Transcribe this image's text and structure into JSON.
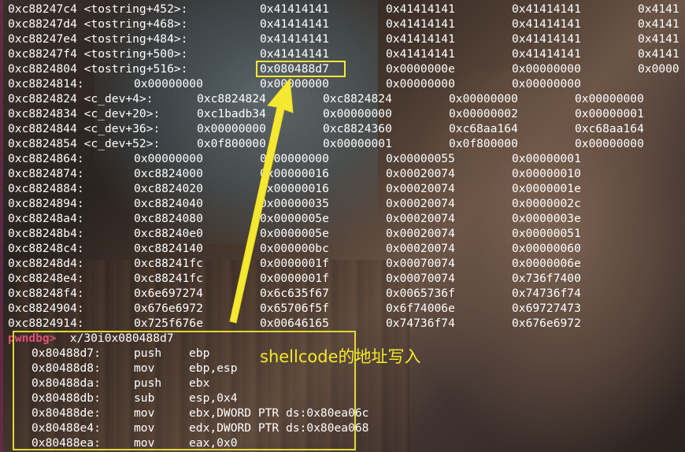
{
  "memory_rows": [
    [
      "0xc88247c4 <tostring+452>:",
      "0x41414141",
      "0x41414141",
      "0x41414141",
      "0x4141"
    ],
    [
      "0xc88247d4 <tostring+468>:",
      "0x41414141",
      "0x41414141",
      "0x41414141",
      "0x4141"
    ],
    [
      "0xc88247e4 <tostring+484>:",
      "0x41414141",
      "0x41414141",
      "0x41414141",
      "0x4141"
    ],
    [
      "0xc88247f4 <tostring+500>:",
      "0x41414141",
      "0x41414141",
      "0x41414141",
      "0x4141"
    ],
    [
      "0xc8824804 <tostring+516>:",
      "0x080488d7",
      "0x0000000e",
      "0x00000000",
      "0x0000"
    ]
  ],
  "row_short": [
    "0xc8824814:",
    "0x00000000",
    "0x00000000",
    "0x00000000",
    "0x00000000"
  ],
  "cdev_rows": [
    [
      "0xc8824824 <c_dev+4>:",
      "0xc8824824",
      "0xc8824824",
      "0x00000000",
      "0x00000000"
    ],
    [
      "0xc8824834 <c_dev+20>:",
      "0xc1badb34",
      "0x00000000",
      "0x00000002",
      "0x00000001"
    ],
    [
      "0xc8824844 <c_dev+36>:",
      "0x00000000",
      "0xc8824360",
      "0xc68aa164",
      "0xc68aa164"
    ],
    [
      "0xc8824854 <c_dev+52>:",
      "0x0f800000",
      "0x00000001",
      "0x0f800000",
      "0x00000000"
    ]
  ],
  "plain_rows": [
    [
      "0xc8824864:",
      "0x00000000",
      "0x00000000",
      "0x00000055",
      "0x00000001"
    ],
    [
      "0xc8824874:",
      "0xc8824000",
      "0x00000016",
      "0x00020074",
      "0x00000010"
    ],
    [
      "0xc8824884:",
      "0xc8824020",
      "0x00000016",
      "0x00020074",
      "0x0000001e"
    ],
    [
      "0xc8824894:",
      "0xc8824040",
      "0x00000035",
      "0x00020074",
      "0x0000002c"
    ],
    [
      "0xc88248a4:",
      "0xc8824080",
      "0x0000005e",
      "0x00020074",
      "0x0000003e"
    ],
    [
      "0xc88248b4:",
      "0xc88240e0",
      "0x0000005e",
      "0x00020074",
      "0x00000051"
    ],
    [
      "0xc88248c4:",
      "0xc8824140",
      "0x000000bc",
      "0x00020074",
      "0x00000060"
    ],
    [
      "0xc88248d4:",
      "0xc88241fc",
      "0x0000001f",
      "0x00070074",
      "0x0000006e"
    ],
    [
      "0xc88248e4:",
      "0xc88241fc",
      "0x0000001f",
      "0x00070074",
      "0x736f7400"
    ],
    [
      "0xc88248f4:",
      "0x6e697274",
      "0x6c635f67",
      "0x0065736f",
      "0x74736f74"
    ],
    [
      "0xc8824904:",
      "0x676e6972",
      "0x65706f5f",
      "0x6f74006e",
      "0x69727473"
    ],
    [
      "0xc8824914:",
      "0x725f676e",
      "0x00646165",
      "0x74736f74",
      "0x676e6972"
    ]
  ],
  "prompt": {
    "name": "pwndbg>",
    "command": " x/30i0x080488d7"
  },
  "disasm": [
    [
      "0x80488d7:",
      "push",
      "ebp"
    ],
    [
      "0x80488d8:",
      "mov",
      "ebp,esp"
    ],
    [
      "0x80488da:",
      "push",
      "ebx"
    ],
    [
      "0x80488db:",
      "sub",
      "esp,0x4"
    ],
    [
      "0x80488de:",
      "mov",
      "ebx,DWORD PTR ds:0x80ea06c"
    ],
    [
      "0x80488e4:",
      "mov",
      "edx,DWORD PTR ds:0x80ea068"
    ],
    [
      "0x80488ea:",
      "mov",
      "eax,0x0"
    ]
  ],
  "annotation": "shellcode的地址写入",
  "colors": {
    "highlight": "#f5e832",
    "prompt": "#e0507a",
    "text": "#ffffff"
  }
}
